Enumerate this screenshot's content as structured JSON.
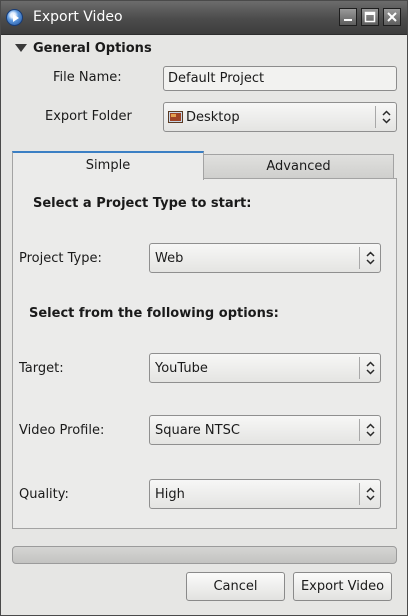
{
  "window": {
    "title": "Export Video",
    "icon": "app-play-icon"
  },
  "general": {
    "section_title": "General Options",
    "file_name_label": "File Name:",
    "file_name_value": "Default Project",
    "export_folder_label": "Export Folder",
    "export_folder_value": "Desktop",
    "export_folder_icon": "folder-icon"
  },
  "tabs": {
    "simple": "Simple",
    "advanced": "Advanced",
    "active": "Simple"
  },
  "simple": {
    "heading_project": "Select a Project Type to start:",
    "project_type_label": "Project Type:",
    "project_type_value": "Web",
    "heading_options": "Select from the following options:",
    "target_label": "Target:",
    "target_value": "YouTube",
    "video_profile_label": "Video Profile:",
    "video_profile_value": "Square NTSC",
    "quality_label": "Quality:",
    "quality_value": "High"
  },
  "progress": {
    "value": 0
  },
  "buttons": {
    "cancel": "Cancel",
    "export": "Export Video"
  },
  "colors": {
    "tab_accent": "#3b7fc4",
    "titlebar": "#4b4b4b",
    "background": "#e6e6e4"
  }
}
